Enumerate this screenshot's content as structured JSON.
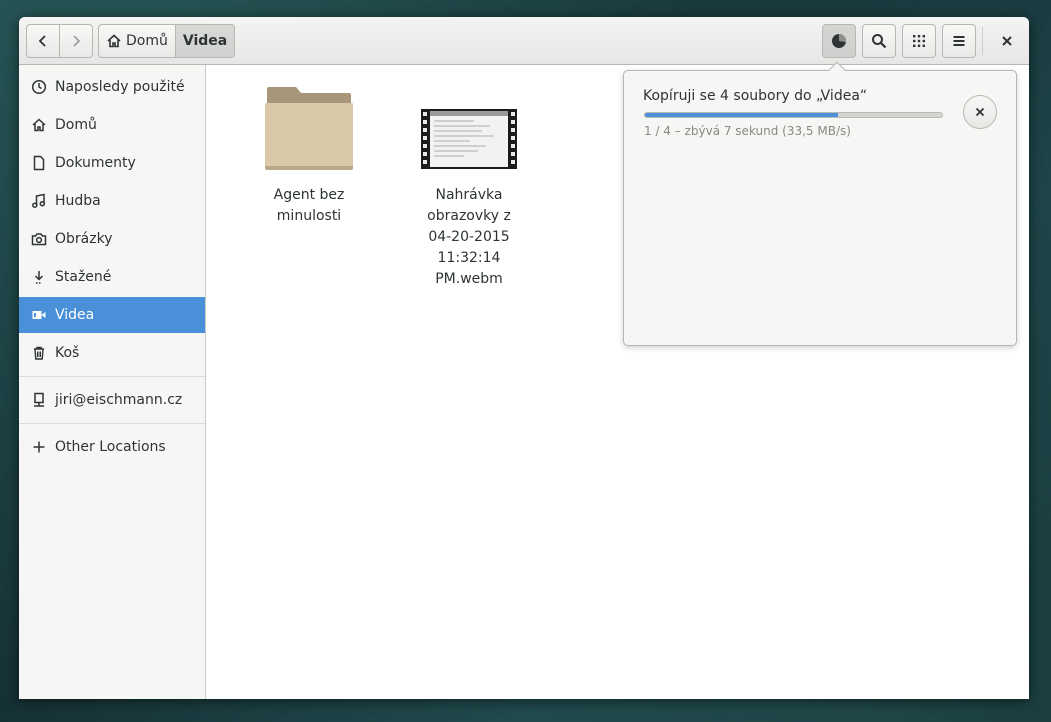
{
  "header": {
    "breadcrumbs": [
      {
        "label": "Domů"
      },
      {
        "label": "Videa"
      }
    ]
  },
  "sidebar": {
    "places": [
      {
        "label": "Naposledy použité",
        "icon": "clock-icon"
      },
      {
        "label": "Domů",
        "icon": "home-icon"
      },
      {
        "label": "Dokumenty",
        "icon": "document-icon"
      },
      {
        "label": "Hudba",
        "icon": "music-icon"
      },
      {
        "label": "Obrázky",
        "icon": "camera-icon"
      },
      {
        "label": "Stažené",
        "icon": "download-icon"
      },
      {
        "label": "Videa",
        "icon": "video-icon",
        "active": true
      },
      {
        "label": "Koš",
        "icon": "trash-icon"
      }
    ],
    "network": {
      "label": "jiri@eischmann.cz",
      "icon": "network-drive-icon"
    },
    "other": {
      "label": "Other Locations",
      "icon": "plus-icon"
    }
  },
  "files": [
    {
      "name": "Agent bez minulosti",
      "type": "folder"
    },
    {
      "name": "Nahrávka obrazovky z 04-20-2015 11:32:14 PM.webm",
      "type": "video"
    }
  ],
  "operation": {
    "title": "Kopíruji se 4 soubory do „Videa“",
    "status": "1 / 4 – zbývá 7 sekund (33,5 MB/s)",
    "progress": 0.65
  },
  "colors": {
    "accent": "#4a90d9",
    "folder": "#d6c4a3"
  }
}
